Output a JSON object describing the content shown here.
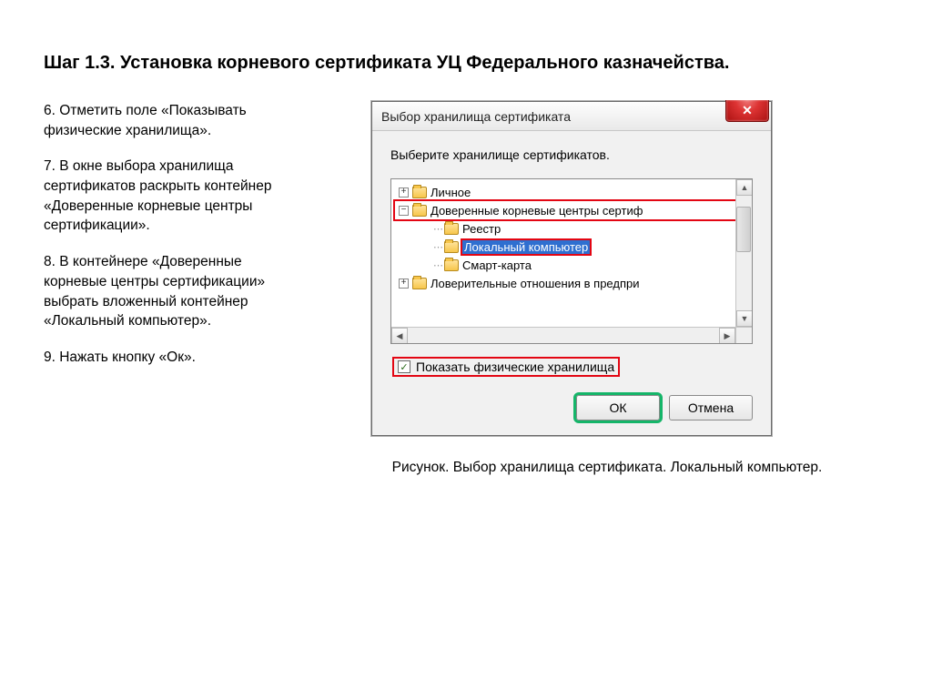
{
  "heading": "Шаг 1.3. Установка корневого сертификата УЦ Федерального казначейства.",
  "steps": {
    "s6": "6. Отметить поле «Показывать физические хранилища».",
    "s7": "7. В окне выбора хранилища сертификатов раскрыть контейнер «Доверенные корневые центры сертификации».",
    "s8": "8. В контейнере «Доверенные корневые центры сертификации» выбрать вложенный контейнер «Локальный компьютер».",
    "s9": "9. Нажать кнопку «Ок»."
  },
  "dialog": {
    "title": "Выбор хранилища сертификата",
    "instruction": "Выберите хранилище сертификатов.",
    "tree": {
      "personal": "Личное",
      "trusted_root": "Доверенные корневые центры сертиф",
      "registry": "Реестр",
      "local_computer": "Локальный компьютер",
      "smart_card": "Смарт-карта",
      "trust_rel": "Ловерительные отношения в предпри",
      "plus": "+",
      "minus": "−"
    },
    "checkbox_label": "Показать физические хранилища",
    "checkmark": "✓",
    "ok": "ОК",
    "cancel": "Отмена",
    "close": "✕"
  },
  "caption": "Рисунок. Выбор хранилища сертификата. Локальный компьютер."
}
